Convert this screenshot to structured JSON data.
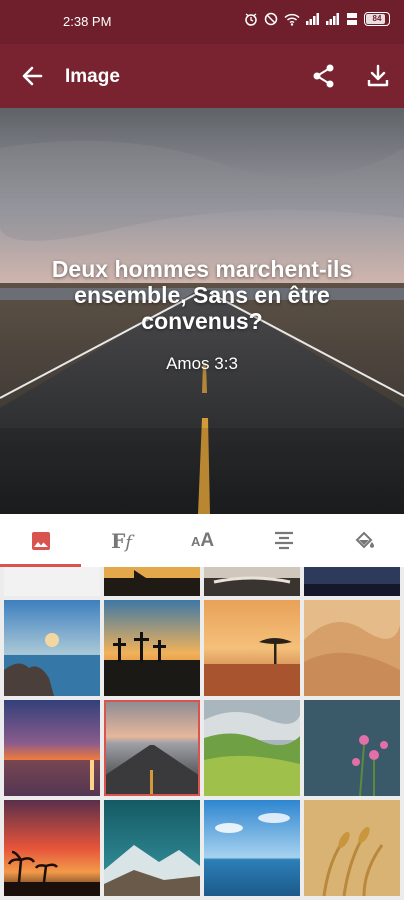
{
  "status_bar": {
    "time": "2:38 PM",
    "battery": "84"
  },
  "app_bar": {
    "title": "Image",
    "back_icon": "arrow-back-icon",
    "share_icon": "share-icon",
    "download_icon": "download-icon"
  },
  "preview": {
    "verse": "Deux hommes marchent-ils ensemble, Sans en être convenus?",
    "reference": "Amos 3:3"
  },
  "tabs": [
    {
      "id": "image",
      "icon": "image-icon",
      "selected": true
    },
    {
      "id": "font",
      "icon": "font-icon",
      "label": "Ff"
    },
    {
      "id": "size",
      "icon": "text-size-icon",
      "label": "AA"
    },
    {
      "id": "align",
      "icon": "align-center-icon"
    },
    {
      "id": "color",
      "icon": "paint-bucket-icon"
    }
  ],
  "gallery": {
    "selected_index": 5
  },
  "colors": {
    "status_bar": "#6f1f2b",
    "app_bar": "#7a2330",
    "accent": "#d9534f"
  }
}
